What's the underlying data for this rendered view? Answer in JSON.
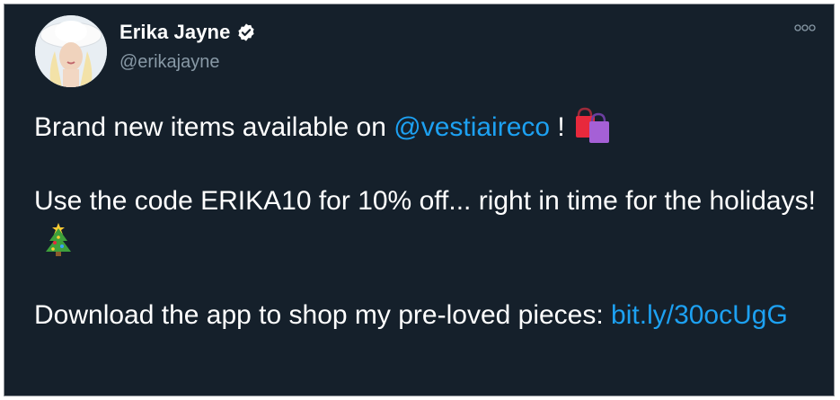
{
  "author": {
    "name": "Erika Jayne",
    "handle": "@erikajayne",
    "verified": true
  },
  "tweet": {
    "line1_before": "Brand new items available on ",
    "mention": "@vestiaireco",
    "line1_after": " !",
    "line1_emoji": "shopping-bags-icon",
    "line2_text": "Use the code ERIKA10 for 10% off... right in time for the holidays!",
    "line2_emoji": "christmas-tree-icon",
    "line3_text": "Download the app to shop my pre-loved pieces: ",
    "link": "bit.ly/30ocUgG"
  },
  "colors": {
    "background": "#15202b",
    "text": "#ffffff",
    "secondary": "#8899a6",
    "link": "#1da1f2"
  }
}
